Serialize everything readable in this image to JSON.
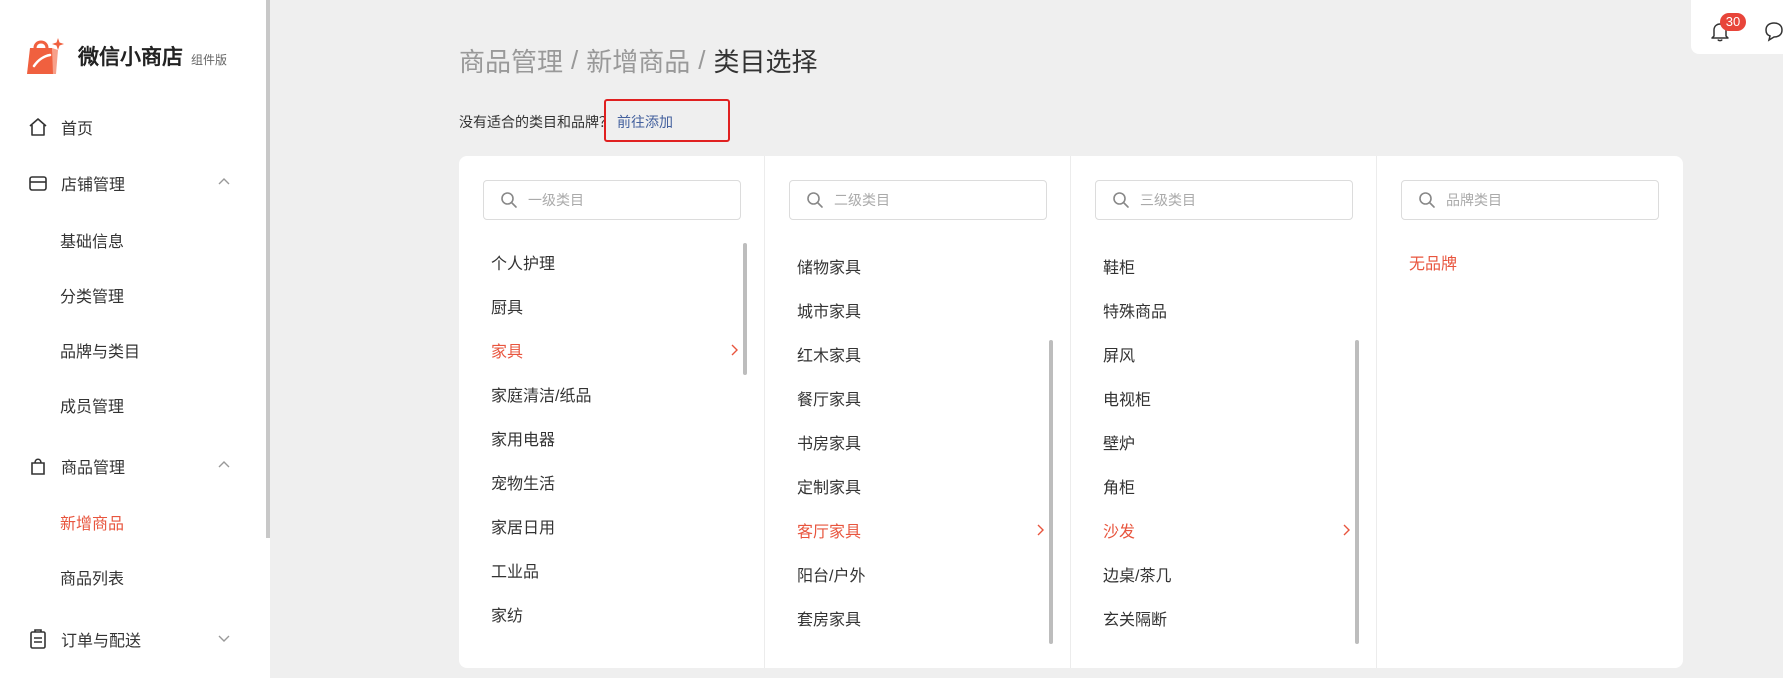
{
  "app": {
    "brand_name": "微信小商店",
    "brand_sub": "组件版"
  },
  "sidebar": {
    "home": "首页",
    "store": {
      "label": "店铺管理",
      "children": [
        "基础信息",
        "分类管理",
        "品牌与类目",
        "成员管理"
      ]
    },
    "goods": {
      "label": "商品管理",
      "children": [
        "新增商品",
        "商品列表"
      ],
      "active": "新增商品"
    },
    "orders": "订单与配送"
  },
  "breadcrumb": {
    "items": [
      "商品管理",
      "新增商品",
      "类目选择"
    ],
    "separator": "/"
  },
  "hint": {
    "text": "没有适合的类目和品牌？",
    "link": "前往添加"
  },
  "columns": [
    {
      "placeholder": "一级类目",
      "items": [
        "个人护理",
        "厨具",
        "家具",
        "家庭清洁/纸品",
        "家用电器",
        "宠物生活",
        "家居日用",
        "工业品",
        "家纺"
      ],
      "active": "家具"
    },
    {
      "placeholder": "二级类目",
      "items": [
        "储物家具",
        "城市家具",
        "红木家具",
        "餐厅家具",
        "书房家具",
        "定制家具",
        "客厅家具",
        "阳台/户外",
        "套房家具"
      ],
      "active": "客厅家具"
    },
    {
      "placeholder": "三级类目",
      "items": [
        "鞋柜",
        "特殊商品",
        "屏风",
        "电视柜",
        "壁炉",
        "角柜",
        "沙发",
        "边桌/茶几",
        "玄关隔断"
      ],
      "active": "沙发"
    },
    {
      "placeholder": "品牌类目",
      "items": [
        "无品牌"
      ],
      "active": "无品牌"
    }
  ],
  "notifications": {
    "count": "30"
  },
  "colors": {
    "accent": "#e8553e",
    "link": "#44619e",
    "highlight_box": "#e02020"
  }
}
